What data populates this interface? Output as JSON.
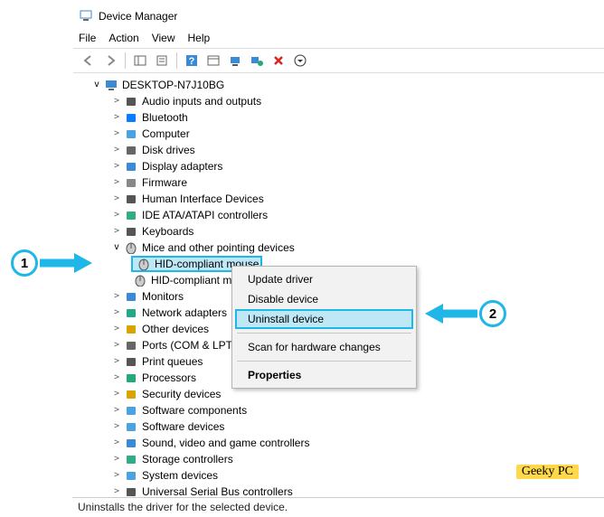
{
  "window": {
    "title": "Device Manager"
  },
  "menubar": [
    "File",
    "Action",
    "View",
    "Help"
  ],
  "toolbar": [
    {
      "name": "back-icon",
      "glyph": "arrow-left"
    },
    {
      "name": "forward-icon",
      "glyph": "arrow-right"
    },
    {
      "sep": true
    },
    {
      "name": "showhide-icon",
      "glyph": "pane"
    },
    {
      "name": "properties-icon",
      "glyph": "props"
    },
    {
      "sep": true
    },
    {
      "name": "help-icon",
      "glyph": "help"
    },
    {
      "name": "showview-icon",
      "glyph": "view"
    },
    {
      "name": "monitor-icon",
      "glyph": "monitor"
    },
    {
      "name": "scan-icon",
      "glyph": "pc-green"
    },
    {
      "name": "remove-icon",
      "glyph": "x-red"
    },
    {
      "name": "more-icon",
      "glyph": "circled-down"
    }
  ],
  "root": "DESKTOP-N7J10BG",
  "categories": [
    {
      "label": "Audio inputs and outputs",
      "icon": "speaker"
    },
    {
      "label": "Bluetooth",
      "icon": "bluetooth"
    },
    {
      "label": "Computer",
      "icon": "computer"
    },
    {
      "label": "Disk drives",
      "icon": "disk"
    },
    {
      "label": "Display adapters",
      "icon": "display"
    },
    {
      "label": "Firmware",
      "icon": "firmware"
    },
    {
      "label": "Human Interface Devices",
      "icon": "hid"
    },
    {
      "label": "IDE ATA/ATAPI controllers",
      "icon": "ide"
    },
    {
      "label": "Keyboards",
      "icon": "keyboard"
    }
  ],
  "expanded_category": {
    "label": "Mice and other pointing devices",
    "icon": "mouse"
  },
  "mice_children": [
    {
      "label": "HID-compliant mouse",
      "selected": true
    },
    {
      "label": "HID-compliant mou",
      "selected": false
    }
  ],
  "categories_after": [
    {
      "label": "Monitors",
      "icon": "monitor-sm"
    },
    {
      "label": "Network adapters",
      "icon": "network"
    },
    {
      "label": "Other devices",
      "icon": "other"
    },
    {
      "label": "Ports (COM & LPT)",
      "icon": "ports"
    },
    {
      "label": "Print queues",
      "icon": "printer"
    },
    {
      "label": "Processors",
      "icon": "cpu"
    },
    {
      "label": "Security devices",
      "icon": "security"
    },
    {
      "label": "Software components",
      "icon": "swcomp"
    },
    {
      "label": "Software devices",
      "icon": "swdev"
    },
    {
      "label": "Sound, video and game controllers",
      "icon": "sound"
    },
    {
      "label": "Storage controllers",
      "icon": "storage"
    },
    {
      "label": "System devices",
      "icon": "system"
    },
    {
      "label": "Universal Serial Bus controllers",
      "icon": "usb",
      "cut": true
    }
  ],
  "context_menu": [
    {
      "label": "Update driver"
    },
    {
      "label": "Disable device"
    },
    {
      "label": "Uninstall device",
      "highlight": true
    },
    {
      "sep": true
    },
    {
      "label": "Scan for hardware changes"
    },
    {
      "sep": true
    },
    {
      "label": "Properties",
      "bold": true
    }
  ],
  "status": "Uninstalls the driver for the selected device.",
  "annotations": {
    "step1": "1",
    "step2": "2",
    "watermark": "Geeky PC"
  },
  "icons": {
    "speaker": "#555",
    "bluetooth": "#0a7cff",
    "computer": "#4aa3e0",
    "disk": "#666",
    "display": "#3a8ad6",
    "firmware": "#888",
    "hid": "#555",
    "ide": "#3a8",
    "keyboard": "#555",
    "mouse": "#777",
    "monitor-sm": "#3a8ad6",
    "network": "#2a8",
    "other": "#d9a400",
    "ports": "#666",
    "printer": "#555",
    "cpu": "#2a7",
    "security": "#d9a400",
    "swcomp": "#4aa3e0",
    "swdev": "#4aa3e0",
    "sound": "#3a8ad6",
    "storage": "#3a8",
    "system": "#4aa3e0",
    "usb": "#555",
    "window": "#3a8ad6",
    "root": "#3a8ad6"
  }
}
